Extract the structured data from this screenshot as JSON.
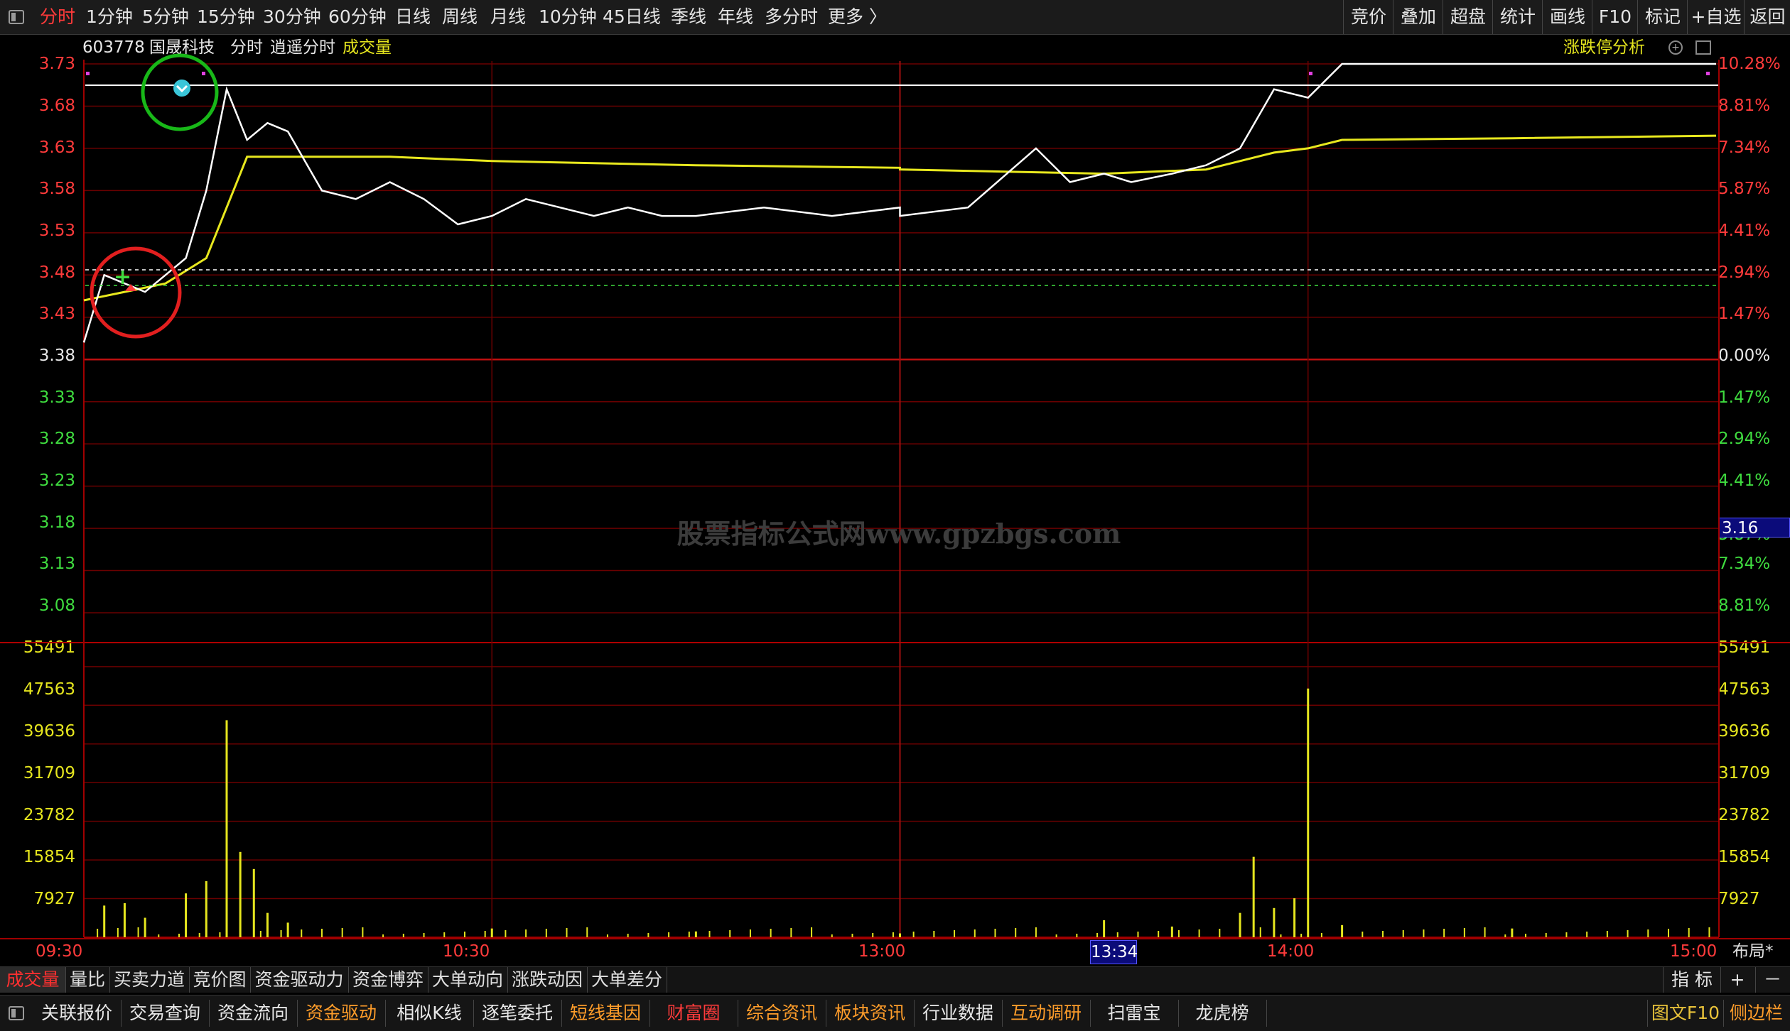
{
  "toolbar": {
    "periods": [
      "分时",
      "1分钟",
      "5分钟",
      "15分钟",
      "30分钟",
      "60分钟",
      "日线",
      "周线",
      "月线",
      "10分钟",
      "45日线",
      "季线",
      "年线",
      "多分时",
      "更多 〉"
    ],
    "tools": [
      "竞价",
      "叠加",
      "超盘",
      "统计",
      "画线",
      "F10",
      "标记",
      "+自选",
      "返回"
    ]
  },
  "header": {
    "code": "603778",
    "name": "国晟科技",
    "mode": "分时",
    "formula": "逍遥分时",
    "indicator": "成交量",
    "right_label": "涨跌停分析"
  },
  "price_axis": {
    "left": [
      {
        "v": "3.73",
        "c": "red"
      },
      {
        "v": "3.68",
        "c": "red"
      },
      {
        "v": "3.63",
        "c": "red"
      },
      {
        "v": "3.58",
        "c": "red"
      },
      {
        "v": "3.53",
        "c": "red"
      },
      {
        "v": "3.48",
        "c": "red"
      },
      {
        "v": "3.43",
        "c": "red"
      },
      {
        "v": "3.38",
        "c": "white"
      },
      {
        "v": "3.33",
        "c": "green"
      },
      {
        "v": "3.28",
        "c": "green"
      },
      {
        "v": "3.23",
        "c": "green"
      },
      {
        "v": "3.18",
        "c": "green"
      },
      {
        "v": "3.13",
        "c": "green"
      },
      {
        "v": "3.08",
        "c": "green"
      }
    ],
    "right": [
      {
        "v": "10.28%",
        "c": "red"
      },
      {
        "v": "8.81%",
        "c": "red"
      },
      {
        "v": "7.34%",
        "c": "red"
      },
      {
        "v": "5.87%",
        "c": "red"
      },
      {
        "v": "4.41%",
        "c": "red"
      },
      {
        "v": "2.94%",
        "c": "red"
      },
      {
        "v": "1.47%",
        "c": "red"
      },
      {
        "v": "0.00%",
        "c": "white"
      },
      {
        "v": "1.47%",
        "c": "green"
      },
      {
        "v": "2.94%",
        "c": "green"
      },
      {
        "v": "4.41%",
        "c": "green"
      },
      {
        "v": "5.87%",
        "c": "green"
      },
      {
        "v": "7.34%",
        "c": "green"
      },
      {
        "v": "8.81%",
        "c": "green"
      }
    ],
    "current_price": "3.16",
    "prev_close": 3.38
  },
  "volume_axis": {
    "labels": [
      "55491",
      "47563",
      "39636",
      "31709",
      "23782",
      "15854",
      "7927"
    ]
  },
  "time_axis": {
    "labels": [
      "09:30",
      "10:30",
      "13:00",
      "14:00",
      "15:00"
    ],
    "cursor_time": "13:34",
    "layout_label": "布局*"
  },
  "watermark": "股票指标公式网www.gpzbgs.com",
  "indicator_tabs": [
    "成交量",
    "量比",
    "买卖力道",
    "竞价图",
    "资金驱动力",
    "资金博弈",
    "大单动向",
    "涨跌动因",
    "大单差分"
  ],
  "indicator_right": [
    "指 标",
    "+",
    "－"
  ],
  "bottom_buttons": [
    {
      "label": "关联报价",
      "c": "white"
    },
    {
      "label": "交易查询",
      "c": "white"
    },
    {
      "label": "资金流向",
      "c": "white"
    },
    {
      "label": "资金驱动",
      "c": "orange"
    },
    {
      "label": "相似K线",
      "c": "white"
    },
    {
      "label": "逐笔委托",
      "c": "white"
    },
    {
      "label": "短线基因",
      "c": "orange"
    },
    {
      "label": "财富圈",
      "c": "red"
    },
    {
      "label": "综合资讯",
      "c": "orange"
    },
    {
      "label": "板块资讯",
      "c": "orange"
    },
    {
      "label": "行业数据",
      "c": "white"
    },
    {
      "label": "互动调研",
      "c": "orange"
    },
    {
      "label": "扫雷宝",
      "c": "white"
    },
    {
      "label": "龙虎榜",
      "c": "white"
    }
  ],
  "bottom_right": [
    {
      "label": "图文F10",
      "c": "gold"
    },
    {
      "label": "侧边栏",
      "c": "orange"
    }
  ],
  "colors": {
    "price_line": "#ffffff",
    "avg_line": "#e8e81e",
    "grid": "#7a0000",
    "up": "#ff3b3b",
    "down": "#3fdc3f",
    "volume": "#e6e61e"
  },
  "chart_data": {
    "type": "line",
    "title": "",
    "x_range": [
      "09:30",
      "15:00"
    ],
    "ylim": [
      3.08,
      3.73
    ],
    "series": [
      {
        "name": "",
        "x": [
          "09:30",
          "09:33",
          "09:36",
          "09:39",
          "09:42",
          "09:45",
          "09:48",
          "09:51",
          "09:54",
          "09:57",
          "10:00",
          "10:05",
          "10:10",
          "10:15",
          "10:20",
          "10:25",
          "10:30",
          "10:35",
          "10:40",
          "10:45",
          "10:50",
          "10:55",
          "11:00",
          "11:10",
          "11:20",
          "11:30",
          "13:00",
          "13:10",
          "13:20",
          "13:25",
          "13:30",
          "13:34",
          "13:40",
          "13:45",
          "13:50",
          "13:55",
          "14:00",
          "14:05",
          "14:10",
          "14:20",
          "14:30",
          "14:40",
          "14:50",
          "15:00"
        ],
        "values": [
          3.4,
          3.48,
          3.47,
          3.46,
          3.48,
          3.5,
          3.58,
          3.7,
          3.64,
          3.66,
          3.65,
          3.58,
          3.57,
          3.59,
          3.57,
          3.54,
          3.55,
          3.57,
          3.56,
          3.55,
          3.56,
          3.55,
          3.55,
          3.56,
          3.55,
          3.56,
          3.55,
          3.56,
          3.63,
          3.59,
          3.6,
          3.59,
          3.6,
          3.61,
          3.63,
          3.7,
          3.69,
          3.73,
          3.73,
          3.73,
          3.73,
          3.73,
          3.73,
          3.73
        ]
      },
      {
        "name": "",
        "x": [
          "09:30",
          "09:36",
          "09:42",
          "09:48",
          "09:54",
          "10:00",
          "10:15",
          "10:30",
          "11:00",
          "11:30",
          "13:00",
          "13:30",
          "13:45",
          "13:50",
          "13:55",
          "14:00",
          "14:05",
          "14:30",
          "15:00"
        ],
        "values": [
          3.45,
          3.46,
          3.47,
          3.5,
          3.62,
          3.62,
          3.62,
          3.615,
          3.61,
          3.607,
          3.605,
          3.6,
          3.605,
          3.615,
          3.625,
          3.63,
          3.64,
          3.642,
          3.645
        ]
      }
    ],
    "volume": {
      "x": [
        "09:33",
        "09:36",
        "09:39",
        "09:45",
        "09:48",
        "09:51",
        "09:53",
        "09:55",
        "09:57",
        "10:00",
        "10:30",
        "11:00",
        "13:00",
        "13:30",
        "13:40",
        "13:50",
        "13:52",
        "13:55",
        "13:58",
        "14:00",
        "14:05",
        "14:30"
      ],
      "values": [
        6500,
        7000,
        4000,
        9000,
        11500,
        44500,
        17500,
        14000,
        5000,
        3000,
        1800,
        1200,
        800,
        3500,
        2200,
        5000,
        16500,
        6000,
        8000,
        51000,
        2500,
        1800
      ]
    }
  }
}
